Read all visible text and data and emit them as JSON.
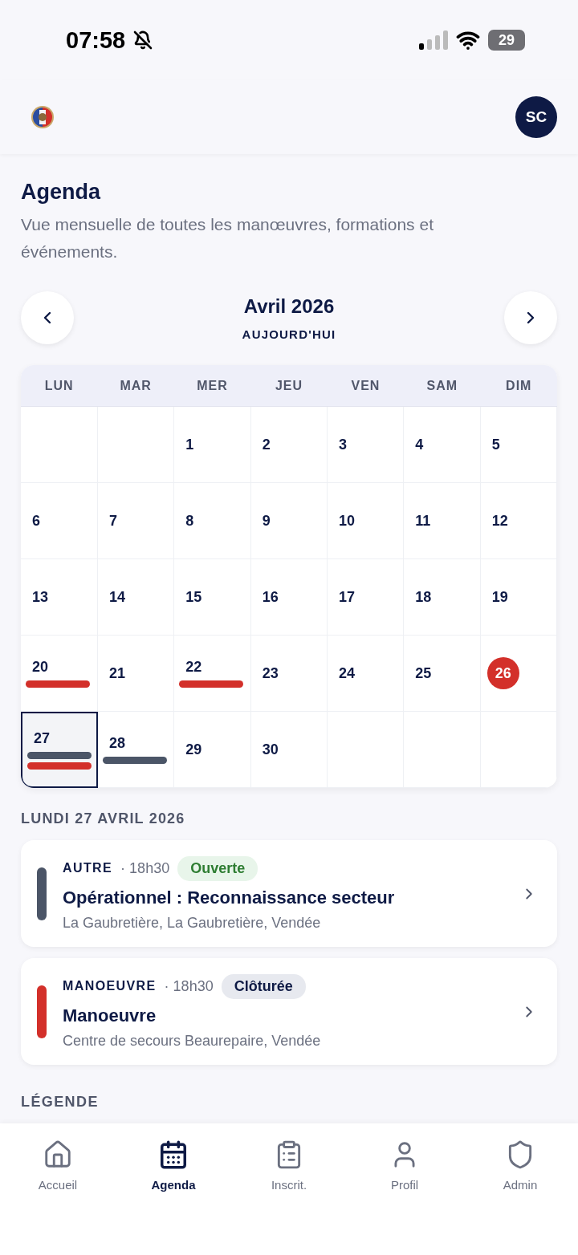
{
  "status_bar": {
    "time": "07:58",
    "battery": "29"
  },
  "header": {
    "avatar": "SC"
  },
  "page": {
    "title": "Agenda",
    "subtitle": "Vue mensuelle de toutes les manœuvres, formations et événements."
  },
  "month_nav": {
    "month": "Avril 2026",
    "today_button": "AUJOURD'HUI"
  },
  "calendar": {
    "weekdays": [
      "LUN",
      "MAR",
      "MER",
      "JEU",
      "VEN",
      "SAM",
      "DIM"
    ],
    "weeks": [
      [
        {
          "kind": "blank"
        },
        {
          "kind": "blank"
        },
        {
          "kind": "day",
          "day": "1",
          "selected": false,
          "today": false
        },
        {
          "kind": "day",
          "day": "2",
          "selected": false,
          "today": false
        },
        {
          "kind": "day",
          "day": "3",
          "selected": false,
          "today": false
        },
        {
          "kind": "day",
          "day": "4",
          "selected": false,
          "today": false
        },
        {
          "kind": "day",
          "day": "5",
          "selected": false,
          "today": false
        }
      ],
      [
        {
          "kind": "day",
          "day": "6",
          "selected": false,
          "today": false
        },
        {
          "kind": "day",
          "day": "7",
          "selected": false,
          "today": false
        },
        {
          "kind": "day",
          "day": "8",
          "selected": false,
          "today": false
        },
        {
          "kind": "day",
          "day": "9",
          "selected": false,
          "today": false
        },
        {
          "kind": "day",
          "day": "10",
          "selected": false,
          "today": false
        },
        {
          "kind": "day",
          "day": "11",
          "selected": false,
          "today": false
        },
        {
          "kind": "day",
          "day": "12",
          "selected": false,
          "today": false
        }
      ],
      [
        {
          "kind": "day",
          "day": "13",
          "selected": false,
          "today": false
        },
        {
          "kind": "day",
          "day": "14",
          "selected": false,
          "today": false
        },
        {
          "kind": "day",
          "day": "15",
          "selected": false,
          "today": false
        },
        {
          "kind": "day",
          "day": "16",
          "selected": false,
          "today": false
        },
        {
          "kind": "day",
          "day": "17",
          "selected": false,
          "today": false
        },
        {
          "kind": "day",
          "day": "18",
          "selected": false,
          "today": false
        },
        {
          "kind": "day",
          "day": "19",
          "selected": false,
          "today": false
        }
      ],
      [
        {
          "kind": "day",
          "day": "20",
          "selected": false,
          "today": false,
          "events": [
            {
              "color": "#d3302a"
            }
          ]
        },
        {
          "kind": "day",
          "day": "21",
          "selected": false,
          "today": false
        },
        {
          "kind": "day",
          "day": "22",
          "selected": false,
          "today": false,
          "events": [
            {
              "color": "#d3302a"
            }
          ]
        },
        {
          "kind": "day",
          "day": "23",
          "selected": false,
          "today": false
        },
        {
          "kind": "day",
          "day": "24",
          "selected": false,
          "today": false
        },
        {
          "kind": "day",
          "day": "25",
          "selected": false,
          "today": false
        },
        {
          "kind": "day",
          "day": "26",
          "selected": false,
          "today": true
        }
      ],
      [
        {
          "kind": "day",
          "day": "27",
          "selected": true,
          "today": false,
          "events": [
            {
              "color": "#4b5567"
            },
            {
              "color": "#d3302a"
            }
          ]
        },
        {
          "kind": "day",
          "day": "28",
          "selected": false,
          "today": false,
          "events": [
            {
              "color": "#4b5567"
            }
          ]
        },
        {
          "kind": "day",
          "day": "29",
          "selected": false,
          "today": false
        },
        {
          "kind": "day",
          "day": "30",
          "selected": false,
          "today": false
        },
        {
          "kind": "blank"
        },
        {
          "kind": "blank"
        },
        {
          "kind": "blank"
        }
      ]
    ]
  },
  "day_heading": "LUNDI 27 AVRIL 2026",
  "events": [
    {
      "category": "AUTRE",
      "time": "· 18h30",
      "status": {
        "label": "Ouverte",
        "kind": "open"
      },
      "title": "Opérationnel : Reconnaissance secteur",
      "place": "La Gaubretière, La Gaubretière, Vendée",
      "color": "#4b5567"
    },
    {
      "category": "MANOEUVRE",
      "time": "· 18h30",
      "status": {
        "label": "Clôturée",
        "kind": "closed"
      },
      "title": "Manoeuvre",
      "place": "Centre de secours Beaurepaire, Vendée",
      "color": "#d3302a"
    }
  ],
  "legend_heading": "LÉGENDE",
  "bottom_nav": [
    {
      "label": "Accueil",
      "selected": false
    },
    {
      "label": "Agenda",
      "selected": true
    },
    {
      "label": "Inscrit.",
      "selected": false
    },
    {
      "label": "Profil",
      "selected": false
    },
    {
      "label": "Admin",
      "selected": false
    }
  ]
}
